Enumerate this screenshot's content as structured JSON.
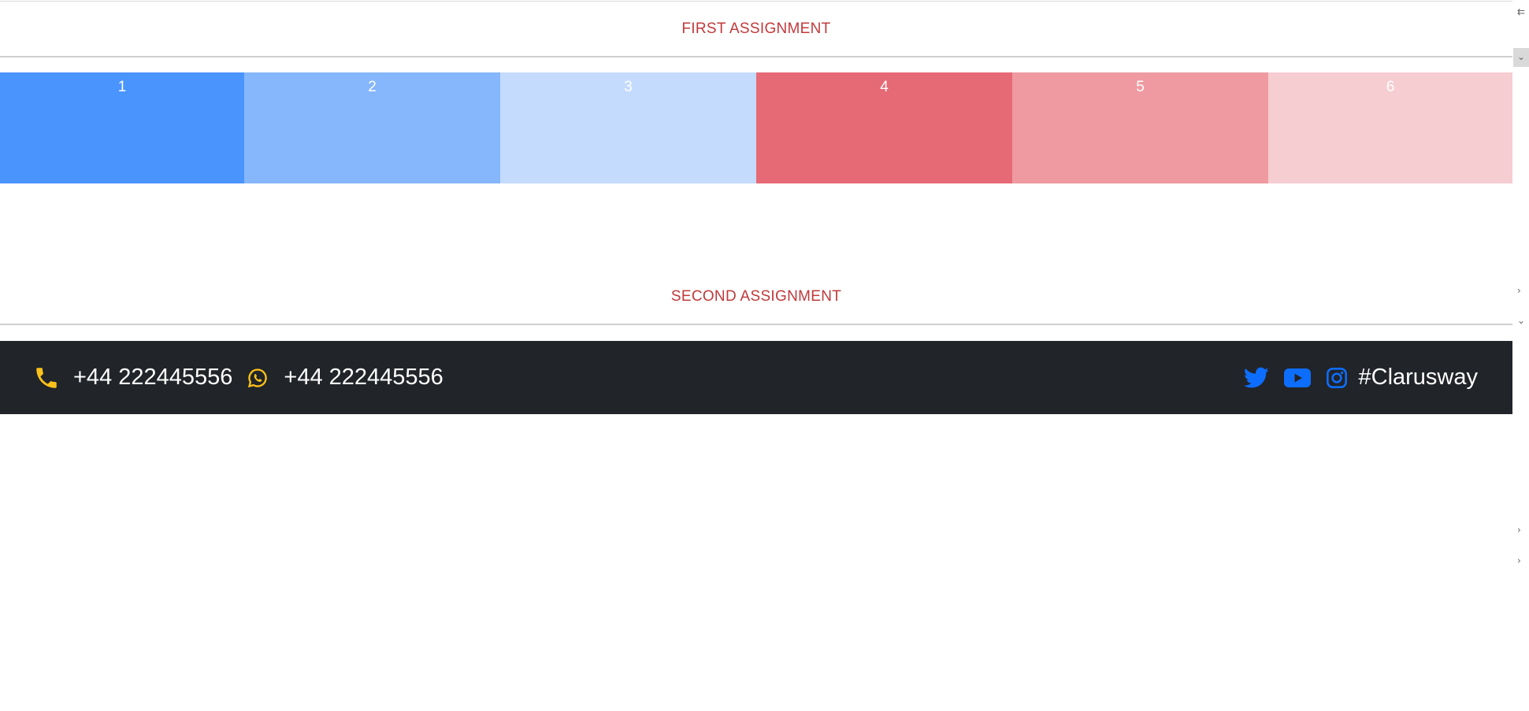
{
  "first_section": {
    "title": "FIRST ASSIGNMENT"
  },
  "boxes": [
    {
      "label": "1",
      "color": "#4a94fd"
    },
    {
      "label": "2",
      "color": "#86b6fc"
    },
    {
      "label": "3",
      "color": "#c4dbfd"
    },
    {
      "label": "4",
      "color": "#e66a75"
    },
    {
      "label": "5",
      "color": "#ee9aa0"
    },
    {
      "label": "6",
      "color": "#f6cdd1"
    }
  ],
  "second_section": {
    "title": "SECOND ASSIGNMENT"
  },
  "footer": {
    "phone": "+44 222445556",
    "whatsapp": "+44 222445556",
    "brand": "#Clarusway",
    "icon_colors": {
      "contact": "#fcc11a",
      "social": "#0d6efd"
    },
    "icons": [
      "phone-icon",
      "whatsapp-icon",
      "twitter-icon",
      "youtube-icon",
      "instagram-icon"
    ]
  },
  "edge_panel": {
    "glyphs": [
      "collapse-arrow-icon",
      "chevron-down-icon",
      "chevron-right-icon",
      "chevron-down-icon",
      "chevron-right-icon",
      "chevron-right-icon"
    ]
  }
}
